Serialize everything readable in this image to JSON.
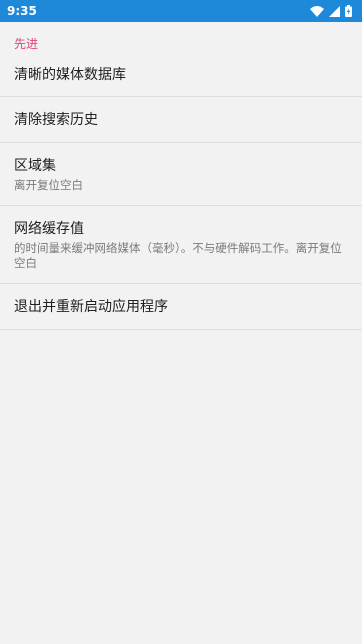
{
  "status_bar": {
    "time": "9:35",
    "icons": [
      "wifi-icon",
      "signal-icon",
      "battery-charging-icon"
    ]
  },
  "colors": {
    "status_bar_bg": "#1e88d9",
    "accent": "#e0457a",
    "background": "#f2f2f2"
  },
  "settings": {
    "section_title": "先进",
    "items": [
      {
        "title": "清晰的媒体数据库"
      },
      {
        "title": "清除搜索历史"
      },
      {
        "title": "区域集",
        "summary": "离开复位空白"
      },
      {
        "title": "网络缓存值",
        "summary": "的时间量来缓冲网络媒体（毫秒）。不与硬件解码工作。离开复位空白"
      },
      {
        "title": "退出并重新启动应用程序"
      }
    ]
  }
}
